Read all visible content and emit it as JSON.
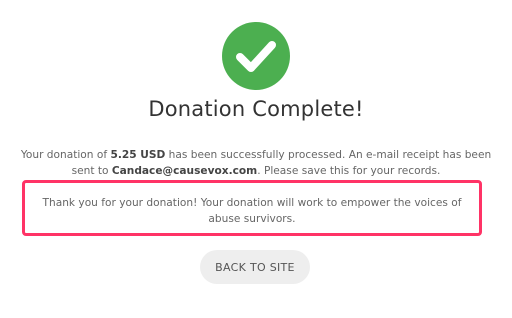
{
  "status": {
    "icon": "checkmark-icon",
    "color": "#4caf50",
    "title": "Donation Complete!"
  },
  "receipt": {
    "prefix": "Your donation of ",
    "amount": "5.25 USD",
    "middle": " has been successfully processed. An e-mail receipt has been sent to ",
    "email": "Candace@causevox.com",
    "suffix": ". Please save this for your records."
  },
  "thank_you": {
    "text": "Thank you for your donation! Your donation will work to empower the voices of abuse survivors.",
    "highlight_color": "#ff3366"
  },
  "actions": {
    "back_label": "BACK TO SITE"
  }
}
